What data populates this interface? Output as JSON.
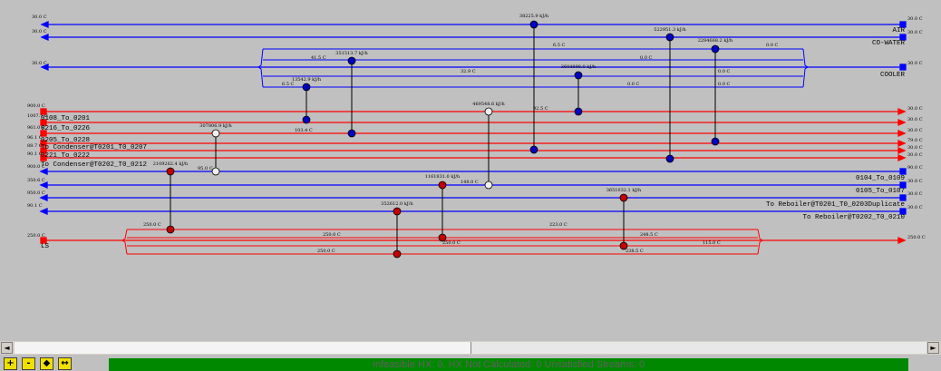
{
  "colors": {
    "hot": "#ff0000",
    "cold": "#0000ff",
    "hx": "#000000",
    "status": "#008800"
  },
  "streams": {
    "air": "AIR",
    "cw": "CO-WATER",
    "cooler": "COOLER",
    "s1": "0108_To_0201",
    "s2": "0216_To_0226",
    "s3": "0205_To_0228",
    "s4": "To Condenser@T0201_T0_0207",
    "s5": "0221_To_0222",
    "s6": "To Condenser@T0202_T0_0212",
    "c1": "0104_To_0109",
    "c2": "0105_To_0107",
    "c3": "To Reboiler@T0201_T0_0203Duplicate",
    "c4": "To Reboiler@T0202_T0_0210",
    "ls": "LS"
  },
  "duties": {
    "d1": "38225.9 kJ/h",
    "d2": "522951.3 kJ/h",
    "d3": "2284668.2 kJ/h",
    "d4": "351513.7 kJ/h",
    "d5": "3604898.0 kJ/h",
    "d6": "13542.9 kJ/h",
    "d7": "469548.6 kJ/h",
    "d8": "307806.9 kJ/h",
    "d9": "2109262.4 kJ/h",
    "d10": "1161831.0 kJ/h",
    "d11": "3651032.1 kJ/h",
    "d12": "352612.0 kJ/h"
  },
  "temps": {
    "t1": "6.5 C",
    "t2": "0.0 C",
    "t3": "41.5 C",
    "t4": "0.0 C",
    "t5": "32.9 C",
    "t6": "0.0 C",
    "t7": "6.5 C",
    "t8": "0.0 C",
    "t9": "0.0 C",
    "t10": "103.4 C",
    "t11": "92.5 C",
    "t12": "95.0 C",
    "t13": "148.0 C",
    "t14": "250.0 C",
    "t15": "250.0 C",
    "t16": "223.0 C",
    "t17": "248.5 C",
    "t18": "250.0 C",
    "t19": "115.0 C",
    "t20": "250.0 C",
    "t21": "238.5 C"
  },
  "edge": {
    "l1": "30.0 C",
    "l2": "30.0 C",
    "l3": "30.0 C",
    "l4": "900.0 C",
    "l5": "1007.1 C",
    "l6": "961.0 C",
    "l7": "96.1 C",
    "l8": "88.7 C",
    "l9": "90.1 C",
    "l10": "900.0 C",
    "l11": "350.6 C",
    "l12": "950.0 C",
    "l13": "90.1 C",
    "l14": "250.0 C",
    "r1": "30.0 C",
    "r2": "30.0 C",
    "r3": "30.0 C",
    "r4": "30.0 C",
    "r5": "30.0 C",
    "r6": "30.0 C",
    "r7": "79.0 C",
    "r8": "30.0 C",
    "r9": "30.0 C",
    "r10": "90.0 C",
    "r11": "30.0 C",
    "r12": "30.0 C",
    "r13": "30.0 C",
    "r14": "250.0 C"
  },
  "status": {
    "text": "Infeasible HX: 0, HX Not Calculated: 0      Unsatisfied Streams: 0"
  },
  "toolbar": {
    "b1": "+",
    "b2": "-",
    "b3": "◆",
    "b4": "↔"
  },
  "scroll": {
    "left": "◄",
    "right": "►"
  }
}
